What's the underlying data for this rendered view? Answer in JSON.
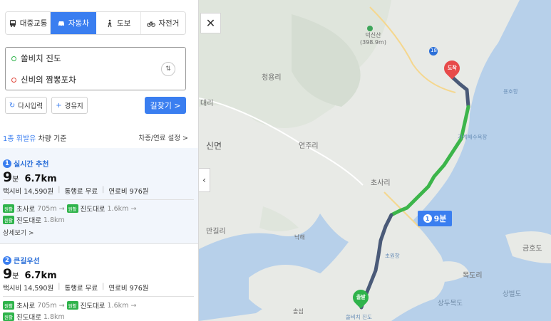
{
  "tabs": [
    {
      "label": "대중교통",
      "icon": "bus-icon"
    },
    {
      "label": "자동차",
      "icon": "car-icon",
      "active": true
    },
    {
      "label": "도보",
      "icon": "walk-icon"
    },
    {
      "label": "자전거",
      "icon": "bicycle-icon"
    }
  ],
  "route_inputs": {
    "origin": "쏠비치 진도",
    "destination": "신비의 짬뽕포차"
  },
  "buttons": {
    "reset": "다시입력",
    "waypoint": "경유지",
    "search": "길찾기 >"
  },
  "fuel": {
    "type": "1종 휘발유",
    "suffix": " 차량 기준",
    "settings": "차종/연료 설정 >"
  },
  "routes": [
    {
      "index": "1",
      "title": "실시간 추천",
      "minutes": "9",
      "min_unit": "분",
      "distance": "6.7km",
      "taxi": "택시비 14,590원",
      "toll": "통행료 무료",
      "fuel": "연료비 976원",
      "road1": "초사로",
      "road1_len": "705m →",
      "road2": "진도대로",
      "road2_len": "1.6km →",
      "road3": "진도대로",
      "road3_len": "1.8km",
      "tag": "원활",
      "detail": "상세보기 >"
    },
    {
      "index": "2",
      "title": "큰길우선",
      "minutes": "9",
      "min_unit": "분",
      "distance": "6.7km",
      "taxi": "택시비 14,590원",
      "toll": "통행료 무료",
      "fuel": "연료비 976원",
      "road1": "초사로",
      "road1_len": "705m →",
      "road2": "진도대로",
      "road2_len": "1.6km →",
      "road3": "진도대로",
      "road3_len": "1.8km",
      "tag": "원활"
    }
  ],
  "map": {
    "labels": {
      "mountain": "덕신산",
      "mountain_height": "(398.9m)",
      "road_no": "18",
      "cheongyong": "청용리",
      "daeri": "대리",
      "sinmyeon": "신면",
      "yeonju": "연주리",
      "chosari": "초사리",
      "mangil": "만길리",
      "nakhae": "낙해",
      "chowon_port": "초원항",
      "yongho_port": "용호항",
      "gagye_beach": "가계해수욕장",
      "songsam": "솔섬",
      "sanghang": "상두목도",
      "sangbeol": "상벌도",
      "mokdo": "목도리",
      "geumhodo": "금호도",
      "solbeach": "쏠비치 진도"
    },
    "arrival_pin": "도착",
    "departure_pin": "출발",
    "time_badge_index": "1",
    "time_badge": "9분"
  },
  "colors": {
    "accent": "#3a7ef0",
    "route_green": "#3cb54a",
    "route_dark": "#4a5a78",
    "arrival": "#e74a4a",
    "departure": "#2fb34b"
  }
}
